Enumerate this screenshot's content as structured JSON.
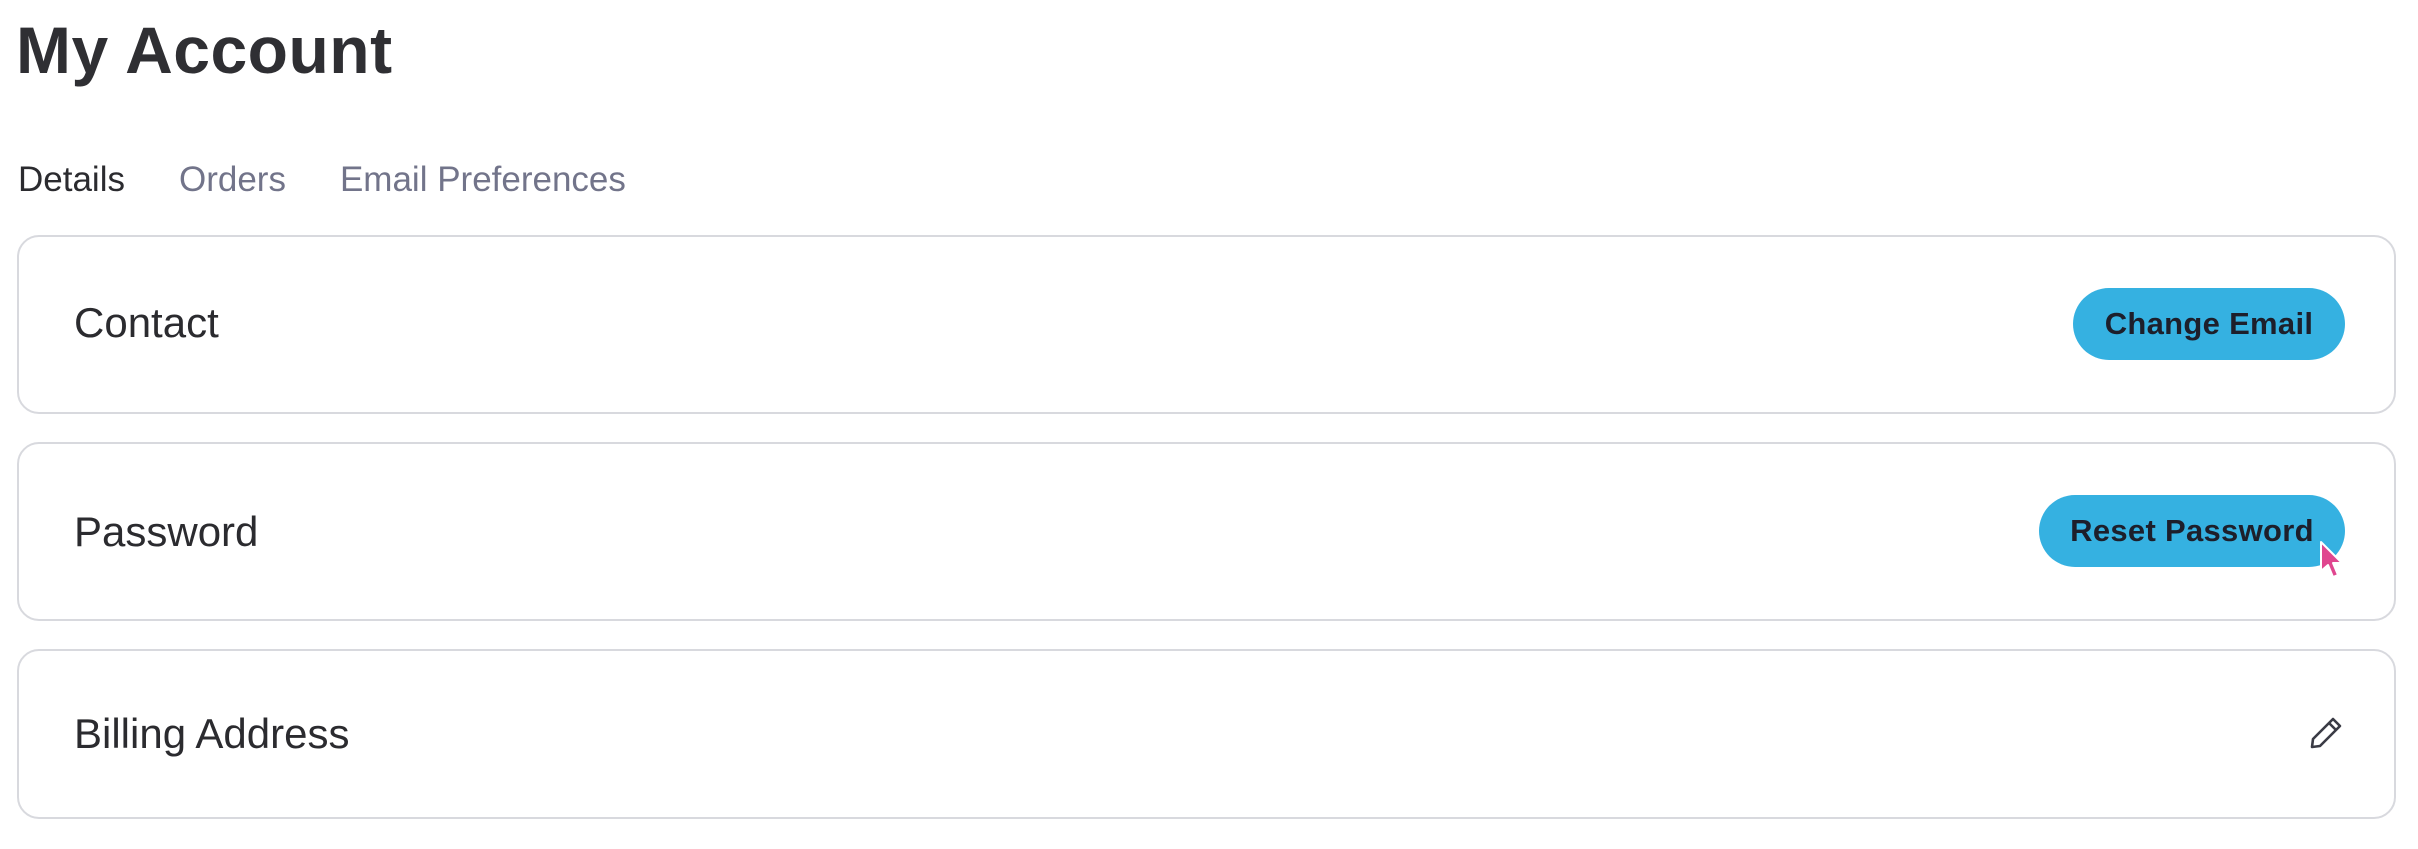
{
  "page": {
    "title": "My Account"
  },
  "tabs": [
    {
      "label": "Details",
      "active": true
    },
    {
      "label": "Orders",
      "active": false
    },
    {
      "label": "Email Preferences",
      "active": false
    }
  ],
  "sections": {
    "contact": {
      "title": "Contact",
      "button_label": "Change Email"
    },
    "password": {
      "title": "Password",
      "button_label": "Reset Password"
    },
    "billing": {
      "title": "Billing Address",
      "action_icon": "pencil-icon"
    }
  },
  "colors": {
    "accent": "#35b1e1",
    "cursor": "#e0468f",
    "border": "#d8d9de",
    "text": "#2b2b2f",
    "muted_text": "#72748a"
  }
}
